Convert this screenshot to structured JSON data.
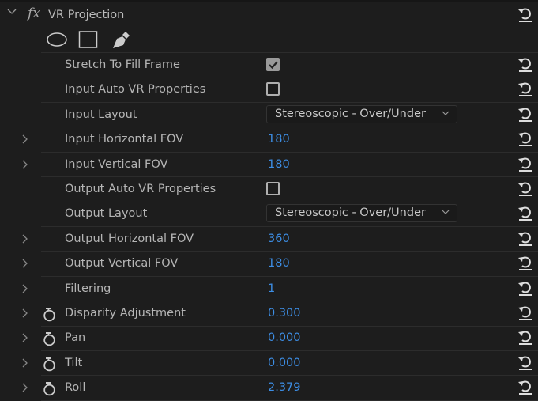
{
  "effect": {
    "title": "VR Projection",
    "fx_label": "fx",
    "mask_tools": [
      "ellipse-mask-icon",
      "rectangle-mask-icon",
      "pen-mask-icon"
    ]
  },
  "properties": [
    {
      "label": "Stretch To Fill Frame",
      "type": "checkbox",
      "checked": true,
      "expandable": false,
      "stopwatch": false
    },
    {
      "label": "Input Auto VR Properties",
      "type": "checkbox",
      "checked": false,
      "expandable": false,
      "stopwatch": false
    },
    {
      "label": "Input Layout",
      "type": "dropdown",
      "value": "Stereoscopic - Over/Under",
      "expandable": false,
      "stopwatch": false
    },
    {
      "label": "Input Horizontal FOV",
      "type": "number",
      "value": "180",
      "expandable": true,
      "stopwatch": false
    },
    {
      "label": "Input Vertical FOV",
      "type": "number",
      "value": "180",
      "expandable": true,
      "stopwatch": false
    },
    {
      "label": "Output Auto VR Properties",
      "type": "checkbox",
      "checked": false,
      "expandable": false,
      "stopwatch": false
    },
    {
      "label": "Output Layout",
      "type": "dropdown",
      "value": "Stereoscopic - Over/Under",
      "expandable": false,
      "stopwatch": false
    },
    {
      "label": "Output Horizontal FOV",
      "type": "number",
      "value": "360",
      "expandable": true,
      "stopwatch": false
    },
    {
      "label": "Output Vertical FOV",
      "type": "number",
      "value": "180",
      "expandable": true,
      "stopwatch": false
    },
    {
      "label": "Filtering",
      "type": "number",
      "value": "1",
      "expandable": true,
      "stopwatch": false
    },
    {
      "label": "Disparity Adjustment",
      "type": "number",
      "value": "0.300",
      "expandable": true,
      "stopwatch": true
    },
    {
      "label": "Pan",
      "type": "number",
      "value": "0.000",
      "expandable": true,
      "stopwatch": true
    },
    {
      "label": "Tilt",
      "type": "number",
      "value": "0.000",
      "expandable": true,
      "stopwatch": true
    },
    {
      "label": "Roll",
      "type": "number",
      "value": "2.379",
      "expandable": true,
      "stopwatch": true
    }
  ],
  "colors": {
    "value": "#3d8ee5",
    "background": "#1d1d1d"
  }
}
